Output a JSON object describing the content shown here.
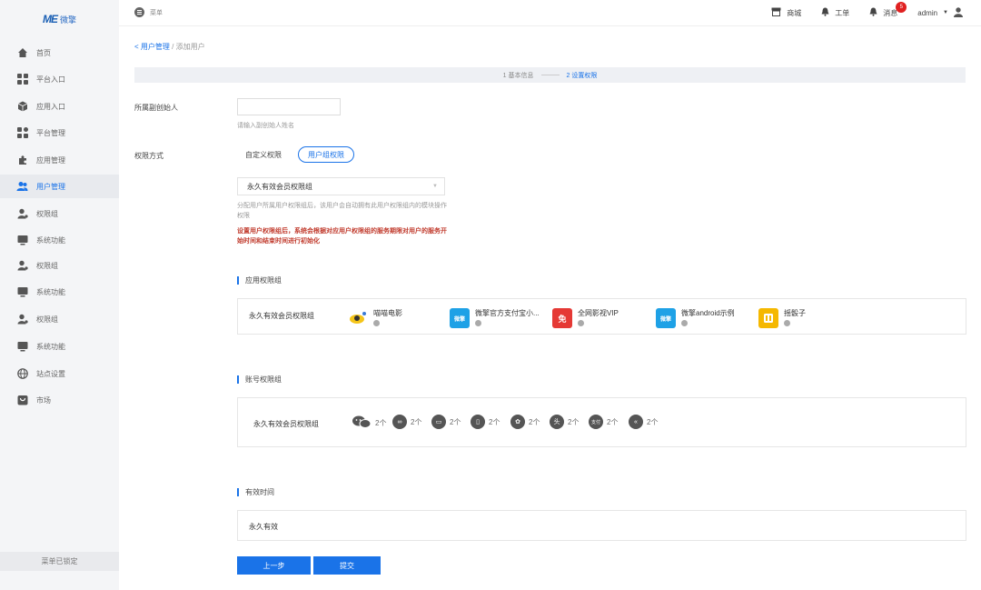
{
  "brand": {
    "mark": "ME",
    "name": "微擎"
  },
  "sidebar": {
    "items": [
      {
        "label": "首页",
        "icon": "home-icon"
      },
      {
        "label": "平台入口",
        "icon": "grid-icon"
      },
      {
        "label": "应用入口",
        "icon": "cube-icon"
      },
      {
        "label": "平台管理",
        "icon": "grid-icon"
      },
      {
        "label": "应用管理",
        "icon": "puzzle-icon"
      },
      {
        "label": "用户管理",
        "icon": "users-icon"
      },
      {
        "label": "权限组",
        "icon": "user-key-icon"
      },
      {
        "label": "系统功能",
        "icon": "monitor-icon"
      },
      {
        "label": "权限组",
        "icon": "user-key-icon"
      },
      {
        "label": "系统功能",
        "icon": "monitor-icon"
      },
      {
        "label": "权限组",
        "icon": "user-key-icon"
      },
      {
        "label": "系统功能",
        "icon": "monitor-icon"
      },
      {
        "label": "站点设置",
        "icon": "globe-icon"
      },
      {
        "label": "市场",
        "icon": "market-icon"
      }
    ],
    "footer": "菜单已锁定"
  },
  "topbar": {
    "menu_label": "菜单",
    "store": "商城",
    "ticket": "工单",
    "messages": "消息",
    "message_count": "5",
    "user": "admin"
  },
  "breadcrumb": {
    "parent": "用户管理",
    "sep": "/",
    "current": "添加用户"
  },
  "steps": {
    "step1": "1 基本信息",
    "step2": "2 设置权限"
  },
  "form": {
    "founder_label": "所属副创始人",
    "founder_hint": "请输入副创始人姓名",
    "perm_label": "权限方式",
    "perm_custom": "自定义权限",
    "perm_group": "用户组权限",
    "group_select": "永久有效会员权限组",
    "group_hint": "分配用户所属用户权限组后，该用户会自动拥有此用户权限组内的模块操作权限",
    "group_warn": "设置用户权限组后，系统会根据对应用户权限组的服务期限对用户的服务开始时间和结束时间进行初始化"
  },
  "app_section": {
    "title": "应用权限组",
    "row_label": "永久有效会员权限组",
    "apps": [
      {
        "name": "喵喵电影",
        "color": "#ffffff"
      },
      {
        "name": "微擎官方支付宝小...",
        "color": "#1ea1e6"
      },
      {
        "name": "全网影视VIP",
        "color": "#e53935"
      },
      {
        "name": "微擎android示例",
        "color": "#1ea1e6"
      },
      {
        "name": "摇骰子",
        "color": "#f5b800"
      }
    ]
  },
  "account_section": {
    "title": "账号权限组",
    "row_label": "永久有效会员权限组",
    "accounts": [
      {
        "count": "2个",
        "icon": "wechat-icon"
      },
      {
        "count": "2个",
        "icon": "miniprogram-icon"
      },
      {
        "count": "2个",
        "icon": "pc-icon"
      },
      {
        "count": "2个",
        "icon": "app-icon"
      },
      {
        "count": "2个",
        "icon": "baidu-icon"
      },
      {
        "count": "2个",
        "icon": "toutiao-icon"
      },
      {
        "count": "2个",
        "icon": "alipay-icon"
      },
      {
        "count": "2个",
        "icon": "other-icon"
      }
    ]
  },
  "validity_section": {
    "title": "有效时间",
    "value": "永久有效"
  },
  "buttons": {
    "prev": "上一步",
    "submit": "提交"
  }
}
